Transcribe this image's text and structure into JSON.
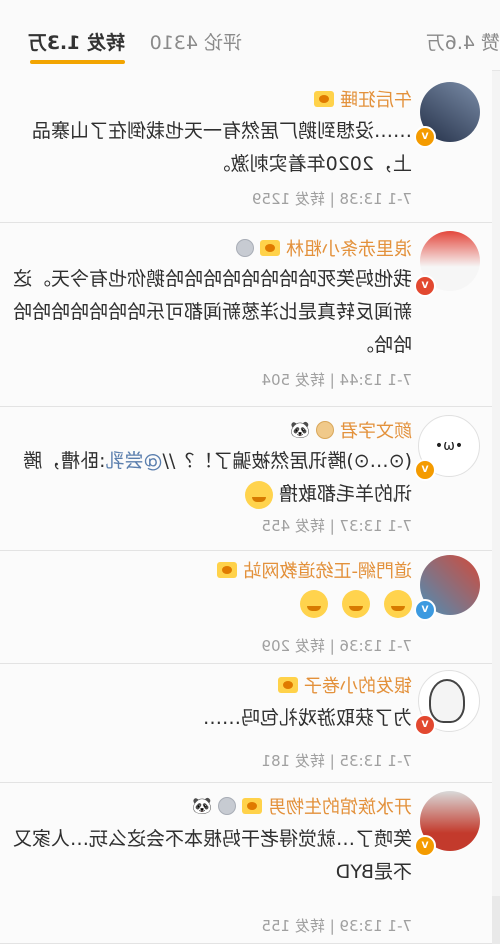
{
  "tabs": {
    "reposts": "转发 1.3万",
    "comments": "评论 4310",
    "likes": "赞 4.6万"
  },
  "items": [
    {
      "name": "午后狂睡",
      "text": "……没想到鹅厂居然有一天也栽倒在了山寨品上，2020年着实刺激。",
      "meta": "7-1 13:38 | 转发 1259"
    },
    {
      "name": "浪里赤条小粗林",
      "text": "我他妈笑死哈哈哈哈哈哈哈哈鹅你也有今天。这新闻反转真是比洋葱新闻都可乐哈哈哈哈哈哈哈哈哈。",
      "meta": "7-1 13:44 | 转发 504"
    },
    {
      "name": "颜文字君",
      "text_prefix": "(⊙…⊙)腾讯居然被骗了！？//",
      "mention": "@尝乳",
      "text_suffix": ":卧槽，腾讯的羊毛都敢撸",
      "meta": "7-1 13:37 | 转发 455"
    },
    {
      "name": "道門網-正统道教网站",
      "meta": "7-1 13:36 | 转发 209"
    },
    {
      "name": "银发的小卷子",
      "text": "为了获取游戏礼包吗……",
      "meta": "7-1 13:35 | 转发 181"
    },
    {
      "name": "开水族馆的生物男",
      "text": "笑喷了…就觉得老干妈根本不会这么玩…人家又不是BYD",
      "meta": "7-1 13:39 | 转发 155"
    }
  ],
  "colors": {
    "accent": "#f2a400",
    "username": "#e3913b",
    "meta_text": "#a0a0a0"
  }
}
